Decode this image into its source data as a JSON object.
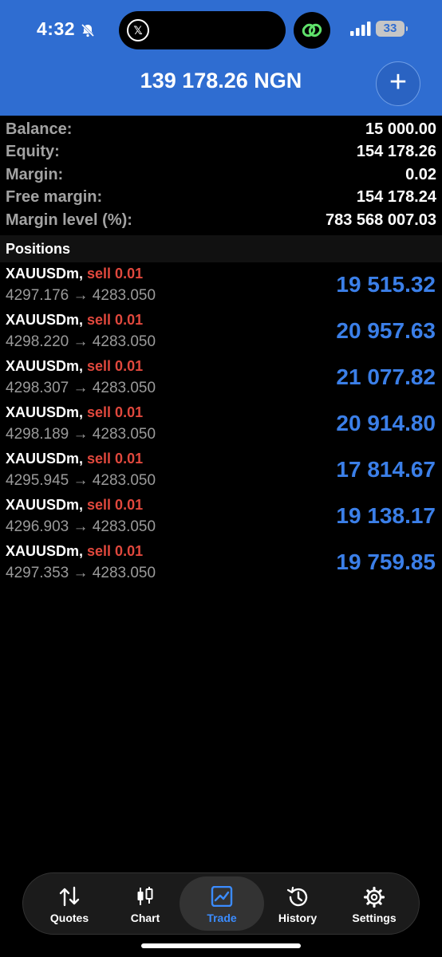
{
  "status": {
    "time": "4:32",
    "battery": "33",
    "x_glyph": "𝕏"
  },
  "header": {
    "title": "139 178.26 NGN",
    "add_glyph": "+"
  },
  "summary": [
    {
      "label": "Balance:",
      "value": "15 000.00"
    },
    {
      "label": "Equity:",
      "value": "154 178.26"
    },
    {
      "label": "Margin:",
      "value": "0.02"
    },
    {
      "label": "Free margin:",
      "value": "154 178.24"
    },
    {
      "label": "Margin level (%):",
      "value": "783 568 007.03"
    }
  ],
  "positions_header": "Positions",
  "positions": [
    {
      "symbol": "XAUUSDm,",
      "side": "sell 0.01",
      "prices": "4297.176 → 4283.050",
      "profit": "19 515.32"
    },
    {
      "symbol": "XAUUSDm,",
      "side": "sell 0.01",
      "prices": "4298.220 → 4283.050",
      "profit": "20 957.63"
    },
    {
      "symbol": "XAUUSDm,",
      "side": "sell 0.01",
      "prices": "4298.307 → 4283.050",
      "profit": "21 077.82"
    },
    {
      "symbol": "XAUUSDm,",
      "side": "sell 0.01",
      "prices": "4298.189 → 4283.050",
      "profit": "20 914.80"
    },
    {
      "symbol": "XAUUSDm,",
      "side": "sell 0.01",
      "prices": "4295.945 → 4283.050",
      "profit": "17 814.67"
    },
    {
      "symbol": "XAUUSDm,",
      "side": "sell 0.01",
      "prices": "4296.903 → 4283.050",
      "profit": "19 138.17"
    },
    {
      "symbol": "XAUUSDm,",
      "side": "sell 0.01",
      "prices": "4297.353 → 4283.050",
      "profit": "19 759.85"
    }
  ],
  "tabs": [
    {
      "label": "Quotes",
      "icon": "quotes-arrows-icon"
    },
    {
      "label": "Chart",
      "icon": "candlestick-icon"
    },
    {
      "label": "Trade",
      "icon": "trade-chart-icon",
      "active": true
    },
    {
      "label": "History",
      "icon": "history-clock-icon"
    },
    {
      "label": "Settings",
      "icon": "gear-icon"
    }
  ],
  "colors": {
    "header_blue": "#2f6dd1",
    "sell_red": "#e0483d",
    "profit_blue": "#3b7fe8",
    "active_tab": "#3b8cff"
  }
}
